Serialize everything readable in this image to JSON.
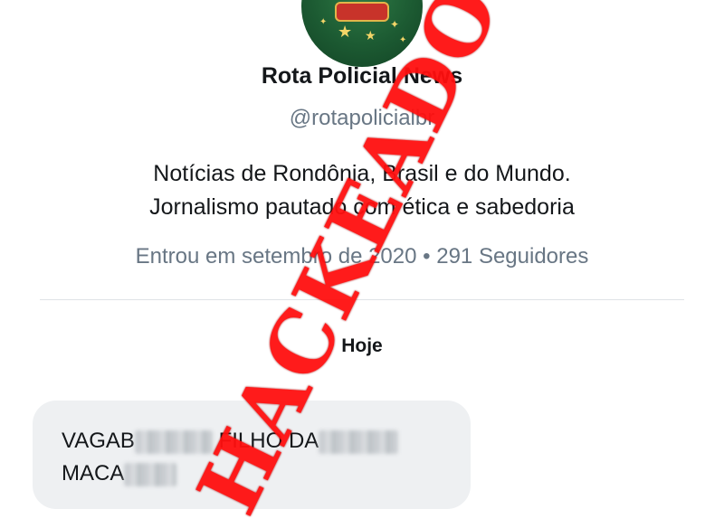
{
  "profile": {
    "name": "Rota Policial News",
    "handle": "@rotapolicialbr",
    "bio_line1": "Notícias de Rondônia, Brasil e do Mundo.",
    "bio_line2": "Jornalismo pautado com ética e sabedoria",
    "joined": "Entrou em setembro de 2020",
    "separator": "•",
    "followers": "291 Seguidores"
  },
  "conversation": {
    "day_label": "Hoje",
    "message": {
      "part1": "VAGAB",
      "part2": "FILHO DA",
      "part3": "MACA"
    }
  },
  "overlay": {
    "stamp_text": "HACKEADO!",
    "stamp_color": "#ff0f0f"
  },
  "icons": {
    "avatar": "christmas-avatar-icon"
  }
}
